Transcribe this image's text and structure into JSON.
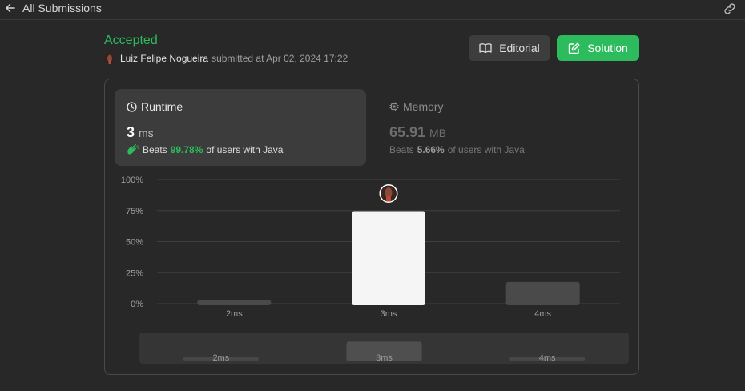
{
  "topbar": {
    "back_label": "All Submissions",
    "back_icon": "arrow-left-icon",
    "link_icon": "link-icon"
  },
  "submission": {
    "status": "Accepted",
    "user": "Luiz Felipe Nogueira",
    "submitted_text": "submitted at Apr 02, 2024 17:22"
  },
  "buttons": {
    "editorial": "Editorial",
    "solution": "Solution"
  },
  "runtime": {
    "title": "Runtime",
    "value": "3",
    "unit": "ms",
    "beats_prefix": "Beats",
    "beats_pct": "99.78%",
    "beats_suffix": "of users with Java"
  },
  "memory": {
    "title": "Memory",
    "value": "65.91",
    "unit": "MB",
    "beats_prefix": "Beats",
    "beats_pct": "5.66%",
    "beats_suffix": "of users with Java"
  },
  "colors": {
    "accent": "#2cbb5d",
    "bar_selected": "#f5f5f5",
    "bar_default": "#4a4a4a"
  },
  "chart_data": {
    "type": "bar",
    "categories": [
      "2ms",
      "3ms",
      "4ms"
    ],
    "values": [
      3,
      74.5,
      17.5
    ],
    "selected": "3ms",
    "y_ticks": [
      "0%",
      "25%",
      "50%",
      "75%",
      "100%"
    ],
    "ylim": [
      0,
      100
    ],
    "grid": true,
    "minimap": {
      "categories": [
        "2ms",
        "3ms",
        "4ms"
      ]
    }
  }
}
